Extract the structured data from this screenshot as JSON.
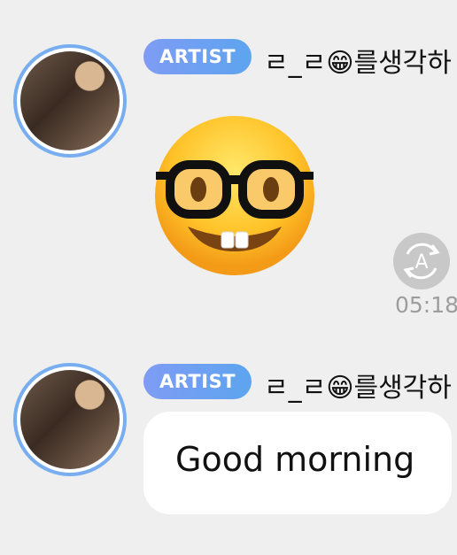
{
  "messages": [
    {
      "badge": "ARTIST",
      "sender": "ㄹ_ㄹ😁를생각하",
      "sticker": "nerd-face-emoji"
    },
    {
      "badge": "ARTIST",
      "sender": "ㄹ_ㄹ😁를생각하",
      "text": "Good morning"
    }
  ],
  "translate_icon_letter": "A",
  "timestamp": "05:18",
  "colors": {
    "badge_start": "#7f9cf5",
    "badge_end": "#5da4ef",
    "avatar_ring": "#78adf0",
    "background": "#efefef",
    "timestamp": "#9d9d9d"
  }
}
